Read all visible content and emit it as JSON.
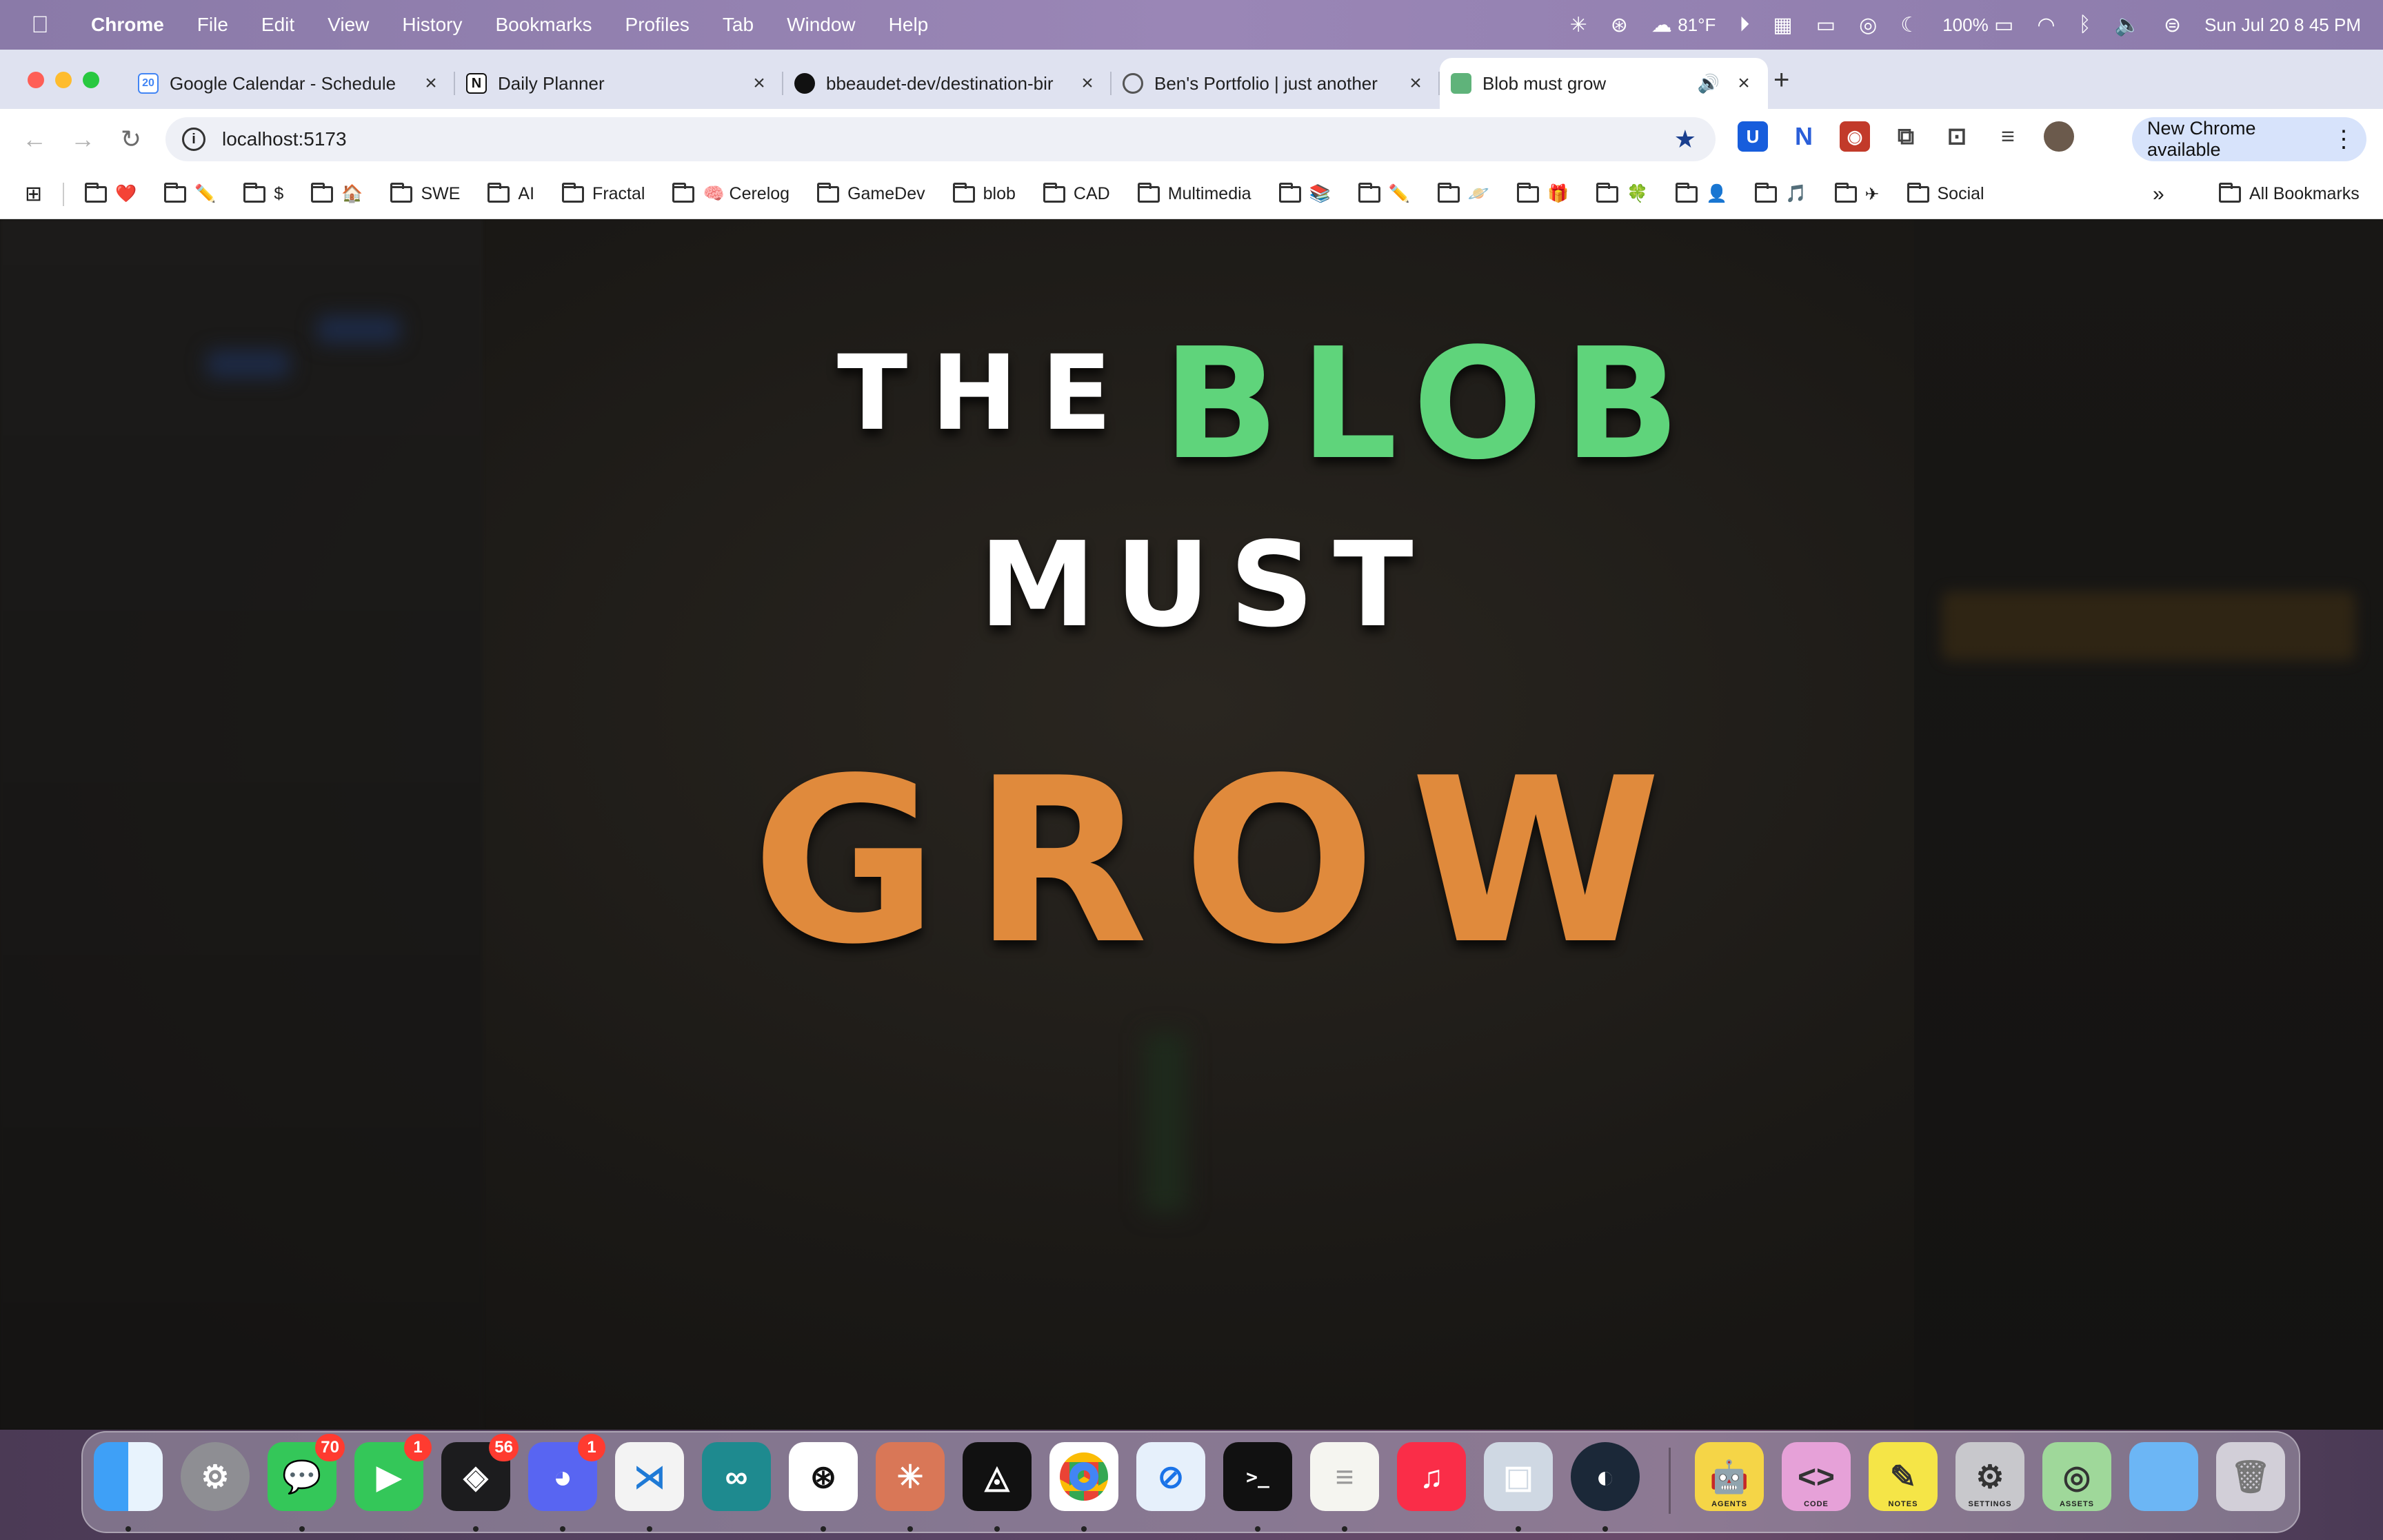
{
  "menubar": {
    "app_name": "Chrome",
    "menus": [
      "File",
      "Edit",
      "View",
      "History",
      "Bookmarks",
      "Profiles",
      "Tab",
      "Window",
      "Help"
    ],
    "temperature": "81°F",
    "battery": "100%",
    "datetime": "Sun Jul 20  8 45 PM"
  },
  "tabs": [
    {
      "title": "Google Calendar - Schedule",
      "favicon": "calendar-icon",
      "badge": "20"
    },
    {
      "title": "Daily Planner",
      "favicon": "notion-icon",
      "badge": "N"
    },
    {
      "title": "bbeaudet-dev/destination-bir",
      "favicon": "github-icon",
      "badge": ""
    },
    {
      "title": "Ben's Portfolio | just another",
      "favicon": "globe-icon",
      "badge": ""
    },
    {
      "title": "Blob must grow",
      "favicon": "blob-icon",
      "badge": "",
      "active": true
    }
  ],
  "toolbar": {
    "url": "localhost:5173",
    "update_label": "New Chrome available"
  },
  "bookmarks": [
    {
      "label": "❤️"
    },
    {
      "label": "✏️"
    },
    {
      "label": "$"
    },
    {
      "label": "🏠"
    },
    {
      "label": "SWE"
    },
    {
      "label": "AI"
    },
    {
      "label": "Fractal"
    },
    {
      "label": "🧠 Cerelog"
    },
    {
      "label": "GameDev"
    },
    {
      "label": "blob"
    },
    {
      "label": "CAD"
    },
    {
      "label": "Multimedia"
    },
    {
      "label": "📚"
    },
    {
      "label": "✏️"
    },
    {
      "label": "🪐"
    },
    {
      "label": "🎁"
    },
    {
      "label": "🍀"
    },
    {
      "label": "👤"
    },
    {
      "label": "🎵"
    },
    {
      "label": "✈"
    },
    {
      "label": "Social"
    }
  ],
  "bookmarks_all": "All Bookmarks",
  "page": {
    "line1_a": "THE",
    "line1_b": "BLOB",
    "line2": "MUST",
    "line3": "GROW"
  },
  "dock": {
    "badges": {
      "messages": "70",
      "facetime": "1",
      "linear": "56",
      "discord": "1"
    },
    "folder_labels": [
      "AGENTS",
      "CODE",
      "NOTES",
      "SETTINGS",
      "ASSETS"
    ]
  },
  "colors": {
    "blob_green": "#5fd47b",
    "grow_orange": "#e08a3c",
    "headline_white": "#ffffff"
  }
}
